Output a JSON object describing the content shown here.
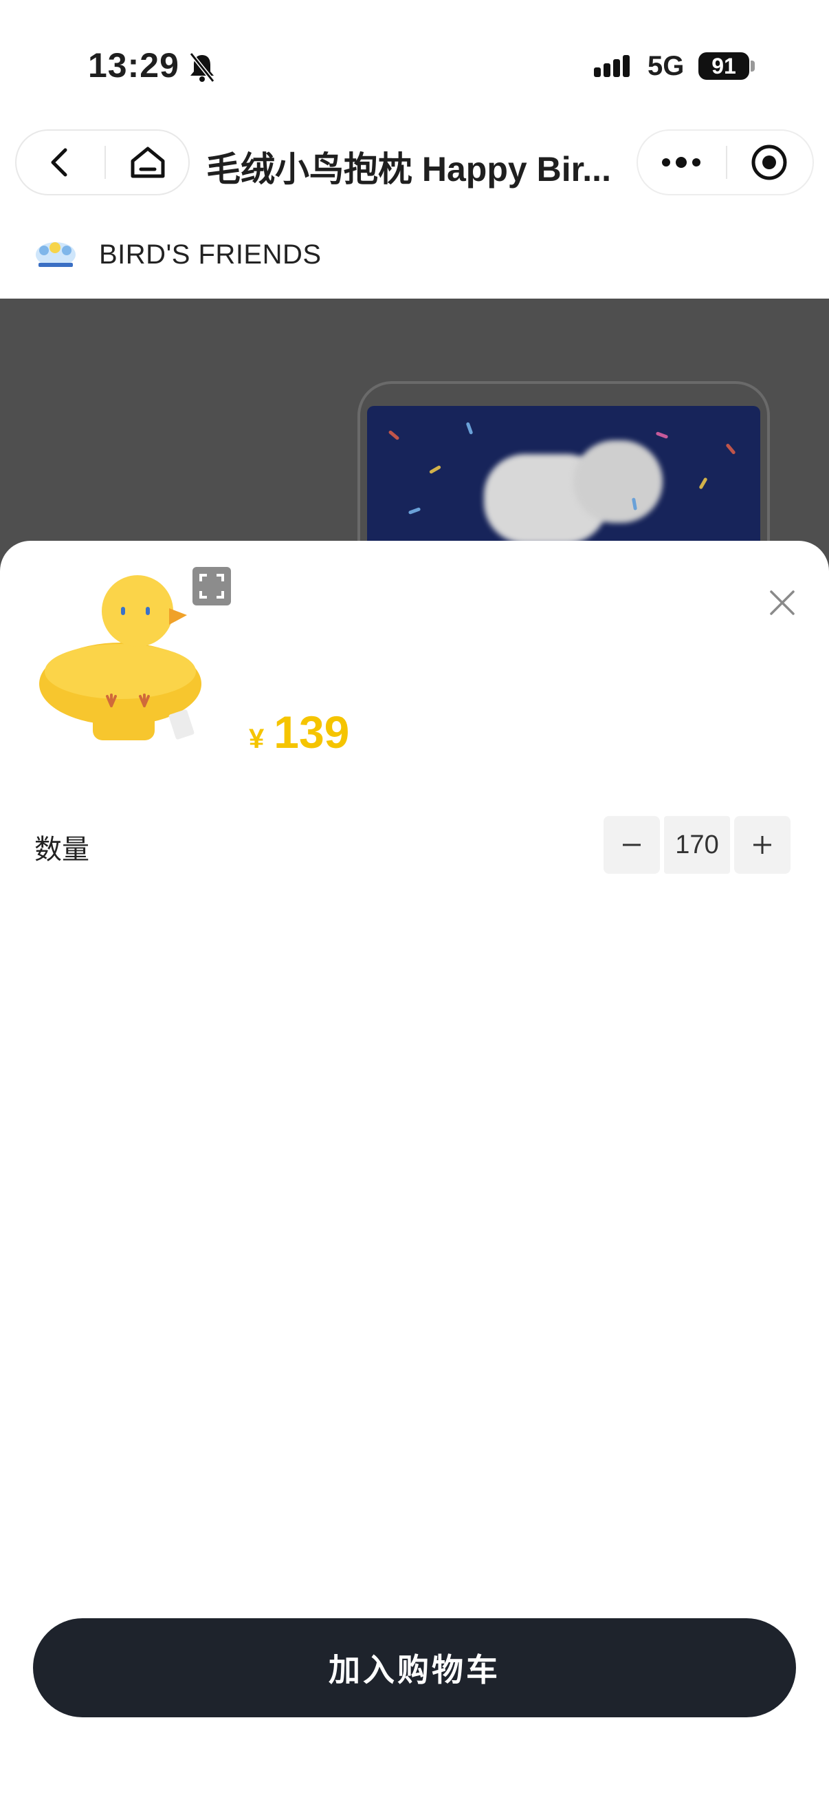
{
  "status_bar": {
    "time": "13:29",
    "network": "5G",
    "battery": "91"
  },
  "nav": {
    "title": "毛绒小鸟抱枕 Happy Bir..."
  },
  "shop": {
    "name": "BIRD'S FRIENDS"
  },
  "product": {
    "currency": "¥",
    "price": "139"
  },
  "quantity": {
    "label": "数量",
    "value": "170",
    "minus": "−",
    "plus": "+"
  },
  "actions": {
    "add_to_cart": "加入购物车"
  },
  "colors": {
    "price": "#f5c400",
    "cart_button": "#1e232c",
    "overlay": "#4f4f4f"
  }
}
